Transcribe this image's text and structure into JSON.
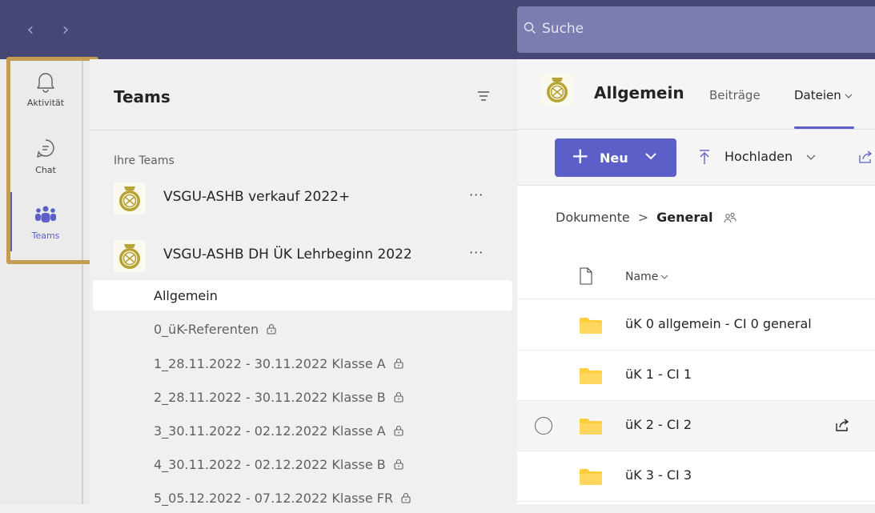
{
  "nav": {
    "back_glyph": "‹",
    "forward_glyph": "›"
  },
  "search": {
    "placeholder": "Suche"
  },
  "rail": {
    "items": [
      {
        "label": "Aktivität",
        "icon": "bell-icon"
      },
      {
        "label": "Chat",
        "icon": "chat-icon"
      },
      {
        "label": "Teams",
        "icon": "teams-icon"
      }
    ],
    "highlight_color": "#c59d52"
  },
  "panel": {
    "title": "Teams",
    "section_label": "Ihre Teams",
    "teams": [
      {
        "name": "VSGU-ASHB verkauf 2022+",
        "more": "···"
      },
      {
        "name": "VSGU-ASHB DH ÜK Lehrbeginn 2022",
        "more": "···"
      }
    ],
    "channels": [
      {
        "name": "Allgemein",
        "locked": false
      },
      {
        "name": "0_üK-Referenten",
        "locked": true
      },
      {
        "name": "1_28.11.2022 - 30.11.2022 Klasse A",
        "locked": true
      },
      {
        "name": "2_28.11.2022 - 30.11.2022 Klasse B",
        "locked": true
      },
      {
        "name": "3_30.11.2022 - 02.12.2022 Klasse A",
        "locked": true
      },
      {
        "name": "4_30.11.2022 - 02.12.2022 Klasse B",
        "locked": true
      },
      {
        "name": "5_05.12.2022 - 07.12.2022 Klasse FR",
        "locked": true
      }
    ]
  },
  "content": {
    "channel_title": "Allgemein",
    "tabs": [
      {
        "label": "Beiträge"
      },
      {
        "label": "Dateien"
      }
    ],
    "toolbar": {
      "new_label": "Neu",
      "upload_label": "Hochladen"
    },
    "breadcrumb": {
      "root": "Dokumente",
      "current": "General"
    },
    "file_header": {
      "name_label": "Name"
    },
    "files": [
      {
        "name": "üK 0 allgemein - CI 0 general"
      },
      {
        "name": "üK 1 - CI 1"
      },
      {
        "name": "üK 2 - CI 2"
      },
      {
        "name": "üK 3 - CI 3"
      }
    ]
  },
  "colors": {
    "brand": "#464775",
    "accent": "#5b5fc7",
    "folder": "#ffce3d"
  }
}
